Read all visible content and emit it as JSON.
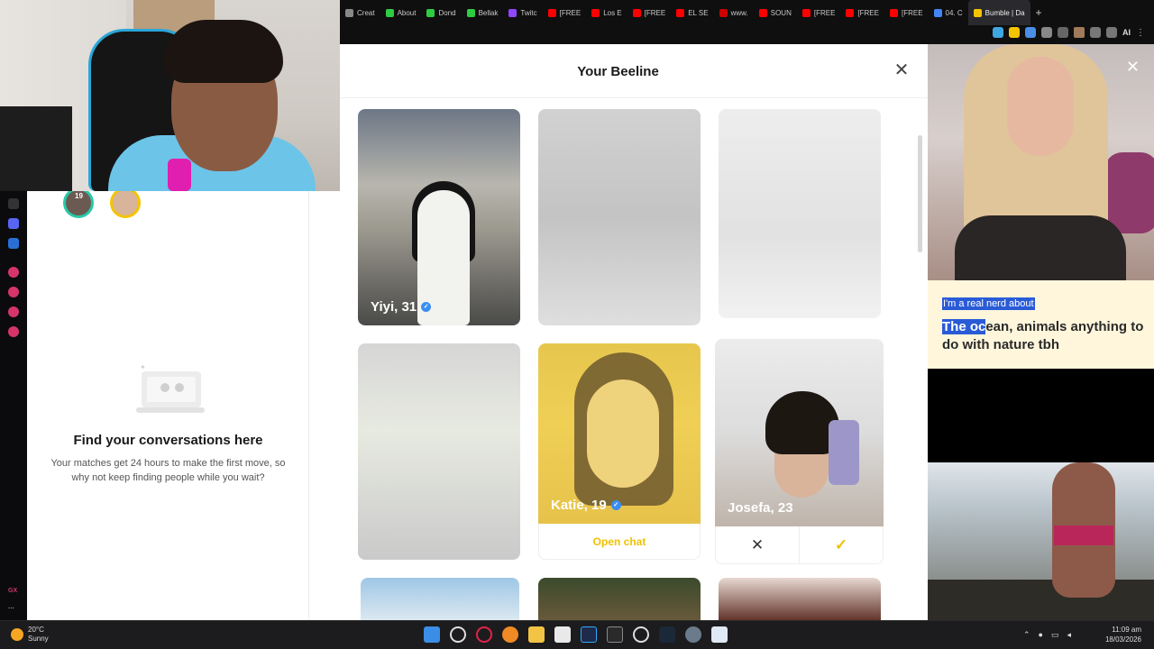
{
  "browser": {
    "tabs": [
      {
        "label": "Creat",
        "color": "#888888"
      },
      {
        "label": "About",
        "color": "#2ecc40"
      },
      {
        "label": "Dond",
        "color": "#2ecc40"
      },
      {
        "label": "Bellak",
        "color": "#2ecc40"
      },
      {
        "label": "Twitc",
        "color": "#9146ff"
      },
      {
        "label": "[FREE",
        "color": "#ff0000"
      },
      {
        "label": "Los E",
        "color": "#ff0000"
      },
      {
        "label": "[FREE",
        "color": "#ff0000"
      },
      {
        "label": "EL SE",
        "color": "#ff0000"
      },
      {
        "label": "www.",
        "color": "#cc0000"
      },
      {
        "label": "SOUN",
        "color": "#ff0000"
      },
      {
        "label": "[FREE",
        "color": "#ff0000"
      },
      {
        "label": "[FREE",
        "color": "#ff0000"
      },
      {
        "label": "[FREE",
        "color": "#ff0000"
      },
      {
        "label": "04. C",
        "color": "#4285f4"
      },
      {
        "label": "Bumble | Da",
        "color": "#f5c400",
        "active": true
      }
    ],
    "new_tab": "+",
    "ext_ai": "AI",
    "ext_menu": "⋮"
  },
  "chat_panel": {
    "avatar_badge": "19",
    "empty_title": "Find your conversations here",
    "empty_subtitle": "Your matches get 24 hours to make the first move, so why not keep finding people while you wait?"
  },
  "beeline": {
    "title": "Your Beeline",
    "close_label": "✕",
    "cards": [
      {
        "name": "Yiyi, 31",
        "verified": true
      },
      {
        "name": "Katie, 19",
        "verified": true,
        "action": "Open chat"
      },
      {
        "name": "Josefa, 23",
        "verified": false,
        "reject": "✕",
        "accept": "✓"
      }
    ]
  },
  "profile": {
    "close_label": "✕",
    "prompt_question": "I'm a real nerd about",
    "prompt_answer_selected": "The oc",
    "prompt_answer_rest": "ean, animals anything to do with nature tbh"
  },
  "taskbar": {
    "weather_temp": "20°C",
    "weather_desc": "Sunny",
    "time": "11:09 am",
    "date": "18/03/2026"
  },
  "rail": {
    "gx_label": "GX",
    "more_label": "···"
  }
}
